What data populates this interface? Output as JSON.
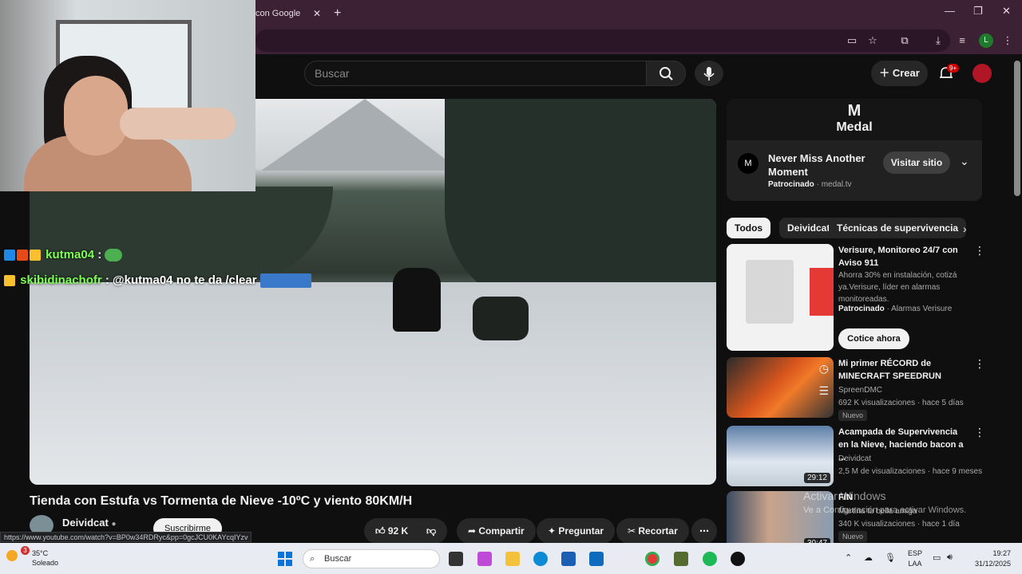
{
  "browser": {
    "tab_title": "con Google",
    "tab_close": "✕",
    "new_tab": "+",
    "window_controls": [
      "—",
      "❐",
      "✕"
    ],
    "profile_initial": "L"
  },
  "youtube": {
    "search_placeholder": "Buscar",
    "create_label": "Crear",
    "notification_count": "9+",
    "video": {
      "title": "Tienda con Estufa vs Tormenta de Nieve -10ºC y viento 80KM/H",
      "channel": "Deividcat",
      "subscribe_label": "Suscribirme",
      "likes": "92 K",
      "share_label": "Compartir",
      "ask_label": "Preguntar",
      "clip_label": "Recortar"
    },
    "chat": [
      {
        "user": "kutma04",
        "message": ":"
      },
      {
        "user": "skibidinachofr",
        "message": ": @kutma04 no te da /clear"
      }
    ],
    "status_url": "https://www.youtube.com/watch?v=BP0w34RDRyc&pp=0gcJCU0KAYcqIYzv",
    "ad": {
      "brand": "Medal",
      "headline": "Never Miss Another Moment",
      "sponsored": "Patrocinado",
      "domain": "medal.tv",
      "visit_label": "Visitar sitio"
    },
    "chips": [
      "Todos",
      "Deividcat",
      "Técnicas de supervivencia"
    ],
    "recommendations": [
      {
        "title": "Verisure, Monitoreo 24/7 con Aviso 911",
        "description": "Ahorra 30% en instalación, cotizá ya.Verisure, líder en alarmas monitoreadas.",
        "sponsored": "Patrocinado",
        "advertiser": "Alarmas Verisure",
        "cta": "Cotice ahora"
      },
      {
        "title": "Mi primer RÉCORD de MINECRAFT SPEEDRUN",
        "channel": "SpreenDMC",
        "stats": "692 K visualizaciones · hace 5 días",
        "badge": "Nuevo"
      },
      {
        "title": "Acampada de Supervivencia en la Nieve, haciendo bacon a ...",
        "channel": "Deividcat",
        "stats": "2,5 M de visualizaciones · hace 9 meses",
        "duration": "29:12"
      },
      {
        "title": "FIN",
        "channel": "Martina tu bella amiga",
        "stats": "340 K visualizaciones · hace 1 día",
        "badge": "Nuevo",
        "duration": "30:47"
      }
    ],
    "activation": {
      "line1": "Activar Windows",
      "line2": "Ve a Configuración para activar Windows."
    }
  },
  "taskbar": {
    "temperature": "35°C",
    "condition": "Soleado",
    "weather_badge": "3",
    "search_label": "Buscar",
    "language": "ESP",
    "layout": "LAA",
    "time": "19:27",
    "date": "31/12/2025"
  },
  "colors": {
    "youtube_bg": "#0f0f0f",
    "chrome_frame": "#3c2134",
    "chat_user": "#7dff52",
    "taskbar": "#e8ecf2"
  }
}
